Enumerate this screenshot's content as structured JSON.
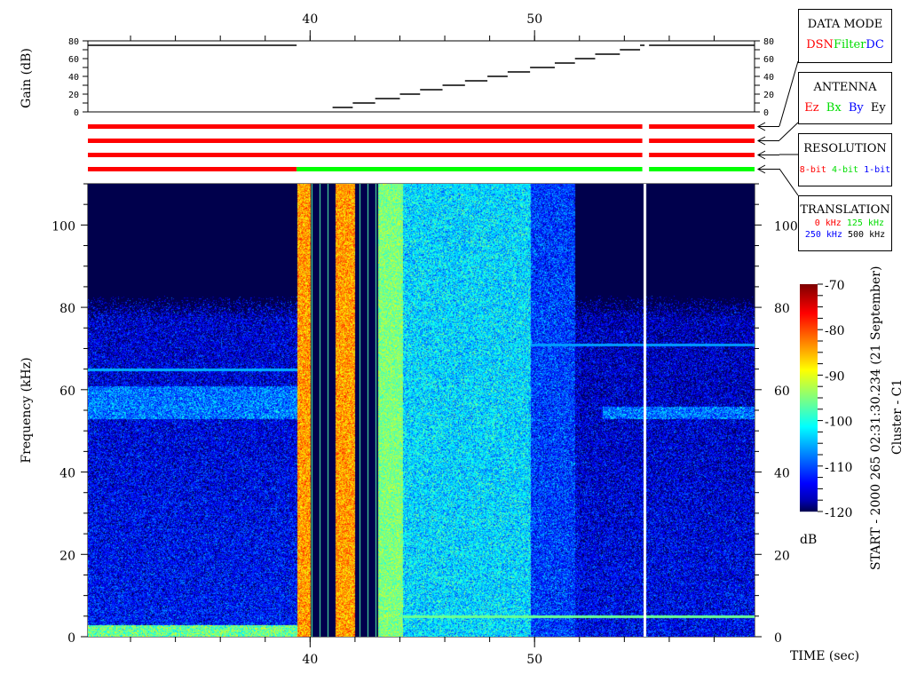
{
  "chart_data": {
    "type": "heatmap",
    "title": "",
    "xlabel": "TIME (sec)",
    "ylabel": "Frequency (kHz)",
    "xlim": [
      30.1,
      59.8
    ],
    "ylim": [
      0,
      110
    ],
    "x_ticks": [
      40,
      50
    ],
    "y_ticks": [
      0,
      20,
      40,
      60,
      80,
      100
    ],
    "colorbar": {
      "label": "dB",
      "range": [
        -120,
        -70
      ],
      "ticks": [
        -70,
        -80,
        -90,
        -100,
        -110,
        -120
      ]
    },
    "start_label": "START - 2000 265 02:31:30.234 (21 September)",
    "spacecraft_label": "Cluster - C1",
    "segments": [
      {
        "t0": 30.1,
        "t1": 39.4,
        "level": -113,
        "spread": 6,
        "cutoff_khz": 80,
        "above_level": -126
      },
      {
        "t0": 39.4,
        "t1": 40.0,
        "level": -84,
        "spread": 5,
        "cutoff_khz": 110,
        "above_level": -84
      },
      {
        "t0": 40.0,
        "t1": 41.1,
        "level": -122,
        "spread": 1,
        "cutoff_khz": 110,
        "above_level": -122,
        "striped": true
      },
      {
        "t0": 41.1,
        "t1": 42.0,
        "level": -84,
        "spread": 5,
        "cutoff_khz": 110,
        "above_level": -84
      },
      {
        "t0": 42.0,
        "t1": 43.0,
        "level": -125,
        "spread": 0,
        "cutoff_khz": 110,
        "above_level": -125,
        "striped": true
      },
      {
        "t0": 43.0,
        "t1": 44.1,
        "level": -95,
        "spread": 4,
        "cutoff_khz": 110,
        "above_level": -95
      },
      {
        "t0": 44.1,
        "t1": 49.8,
        "level": -103,
        "spread": 6,
        "cutoff_khz": 110,
        "above_level": -103
      },
      {
        "t0": 49.8,
        "t1": 51.8,
        "level": -111,
        "spread": 6,
        "cutoff_khz": 110,
        "above_level": -111
      },
      {
        "t0": 51.8,
        "t1": 59.8,
        "level": -114,
        "spread": 6,
        "cutoff_khz": 80,
        "above_level": -126
      }
    ],
    "bands": [
      {
        "t0": 30.1,
        "t1": 39.4,
        "f0": 53,
        "f1": 61,
        "level": -104
      },
      {
        "t0": 30.1,
        "t1": 39.4,
        "f0": 0,
        "f1": 3,
        "level": -92
      },
      {
        "t0": 53.0,
        "t1": 59.8,
        "f0": 53,
        "f1": 56,
        "level": -104
      }
    ],
    "lines": [
      {
        "t0": 30.1,
        "t1": 39.4,
        "f": 65,
        "level": -105
      },
      {
        "t0": 49.8,
        "t1": 59.8,
        "f": 71,
        "level": -106
      },
      {
        "t0": 44.1,
        "t1": 59.8,
        "f": 5,
        "level": -96
      }
    ],
    "data_gap_time": 54.9,
    "gain": {
      "ylabel": "Gain (dB)",
      "ylim": [
        0,
        80
      ],
      "y_ticks": [
        0,
        20,
        40,
        60,
        80
      ],
      "steps": [
        {
          "t0": 30.1,
          "t1": 39.4,
          "gain": 75
        },
        {
          "t0": 41.0,
          "t1": 41.9,
          "gain": 5
        },
        {
          "t0": 41.9,
          "t1": 42.9,
          "gain": 10
        },
        {
          "t0": 42.9,
          "t1": 44.0,
          "gain": 15
        },
        {
          "t0": 44.0,
          "t1": 44.9,
          "gain": 20
        },
        {
          "t0": 44.9,
          "t1": 45.9,
          "gain": 25
        },
        {
          "t0": 45.9,
          "t1": 46.9,
          "gain": 30
        },
        {
          "t0": 46.9,
          "t1": 47.9,
          "gain": 35
        },
        {
          "t0": 47.9,
          "t1": 48.8,
          "gain": 40
        },
        {
          "t0": 48.8,
          "t1": 49.8,
          "gain": 45
        },
        {
          "t0": 49.8,
          "t1": 50.9,
          "gain": 50
        },
        {
          "t0": 50.9,
          "t1": 51.8,
          "gain": 55
        },
        {
          "t0": 51.8,
          "t1": 52.7,
          "gain": 60
        },
        {
          "t0": 52.7,
          "t1": 53.8,
          "gain": 65
        },
        {
          "t0": 53.8,
          "t1": 54.7,
          "gain": 70
        },
        {
          "t0": 54.7,
          "t1": 54.9,
          "gain": 75
        },
        {
          "t0": 55.1,
          "t1": 59.8,
          "gain": 75
        }
      ]
    },
    "status_bars": [
      {
        "name": "data-mode",
        "segments": [
          {
            "t0": 30.1,
            "t1": 54.8,
            "color": "#ff0000"
          },
          {
            "t0": 55.1,
            "t1": 59.8,
            "color": "#ff0000"
          }
        ]
      },
      {
        "name": "antenna",
        "segments": [
          {
            "t0": 30.1,
            "t1": 54.8,
            "color": "#ff0000"
          },
          {
            "t0": 55.1,
            "t1": 59.8,
            "color": "#ff0000"
          }
        ]
      },
      {
        "name": "resolution",
        "segments": [
          {
            "t0": 30.1,
            "t1": 54.8,
            "color": "#ff0000"
          },
          {
            "t0": 55.1,
            "t1": 59.8,
            "color": "#ff0000"
          }
        ]
      },
      {
        "name": "translation",
        "segments": [
          {
            "t0": 30.1,
            "t1": 39.4,
            "color": "#ff0000"
          },
          {
            "t0": 39.4,
            "t1": 54.8,
            "color": "#00ff00"
          },
          {
            "t0": 55.1,
            "t1": 59.8,
            "color": "#00ff00"
          }
        ]
      }
    ]
  },
  "legends": {
    "data_mode": {
      "title": "DATA MODE",
      "items": [
        {
          "text": "DSN",
          "color": "#ff0000"
        },
        {
          "text": "Filter",
          "color": "#00dd00"
        },
        {
          "text": "DC",
          "color": "#0000ff"
        }
      ]
    },
    "antenna": {
      "title": "ANTENNA",
      "items": [
        {
          "text": "Ez",
          "color": "#ff0000"
        },
        {
          "text": "Bx",
          "color": "#00dd00"
        },
        {
          "text": "By",
          "color": "#0000ff"
        },
        {
          "text": "Ey",
          "color": "#000000"
        }
      ]
    },
    "resolution": {
      "title": "RESOLUTION",
      "items": [
        {
          "text": "8-bit",
          "color": "#ff0000"
        },
        {
          "text": "4-bit",
          "color": "#00dd00"
        },
        {
          "text": "1-bit",
          "color": "#0000ff"
        }
      ]
    },
    "translation": {
      "title": "TRANSLATION",
      "items": [
        {
          "text": "0 kHz",
          "color": "#ff0000"
        },
        {
          "text": "125 kHz",
          "color": "#00dd00"
        },
        {
          "text": "250 kHz",
          "color": "#0000ff"
        },
        {
          "text": "500 kHz",
          "color": "#000000"
        }
      ]
    }
  }
}
